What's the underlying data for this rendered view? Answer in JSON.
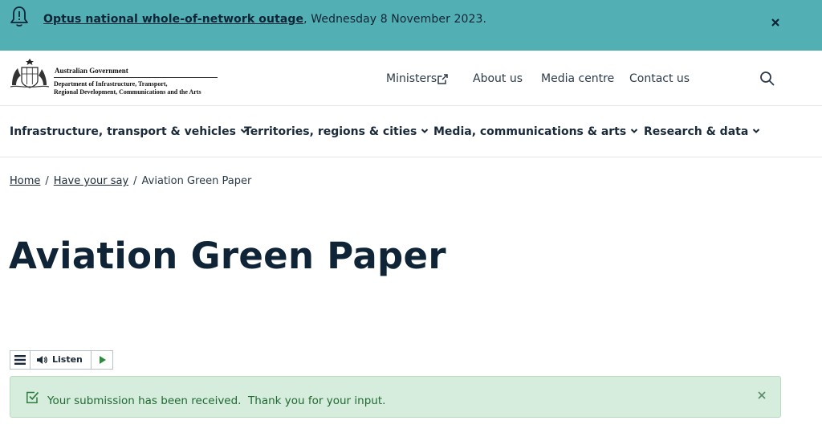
{
  "alert": {
    "link_text": "Optus national whole-of-network outage",
    "rest_text": ", Wednesday 8 November 2023.",
    "icon": "bell-icon",
    "close_icon": "close-icon"
  },
  "header": {
    "gov_name": "Australian Government",
    "dept_line1": "Department of Infrastructure, Transport,",
    "dept_line2": "Regional Development, Communications and the Arts",
    "utility_links": [
      "Ministers",
      "About us",
      "Media centre",
      "Contact us"
    ],
    "search_icon": "search-icon"
  },
  "nav": {
    "items": [
      "Infrastructure, transport & vehicles",
      "Territories, regions & cities",
      "Media, communications & arts",
      "Research & data"
    ]
  },
  "breadcrumb": {
    "home": "Home",
    "have_your_say": "Have your say",
    "separator": "/",
    "current": "Aviation Green Paper"
  },
  "page": {
    "title": "Aviation Green Paper"
  },
  "listen": {
    "label": "Listen"
  },
  "message": {
    "text": "Your submission has been received.  Thank you for your input."
  },
  "colors": {
    "alert_bg": "#52b0b5",
    "title": "#0f2436",
    "success_bg": "#d6ecdc",
    "success_text": "#1f6a32"
  }
}
